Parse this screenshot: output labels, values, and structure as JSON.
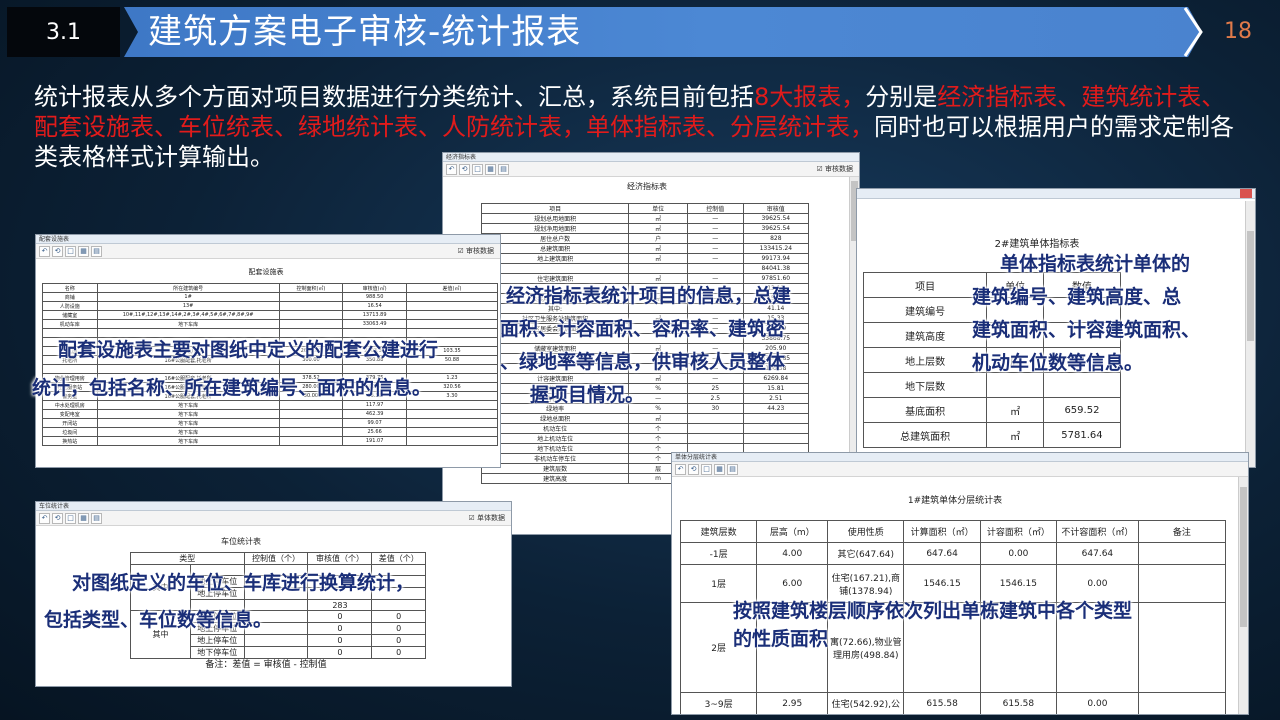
{
  "header": {
    "section": "3.1",
    "title": "建筑方案电子审核-统计报表",
    "page": "18"
  },
  "intro": {
    "p1": "统计报表从多个方面对项目数据进行分类统计、汇总，系统目前包括",
    "p2": "8大报表，",
    "p3": "分别是",
    "p4": "经济指标表、建筑统计表、配套设施表、车位统表、绿地统计表、人防统计表，单体指标表、分层统计表，",
    "p5": "同时也可以根据用户的需求定制各类表格样式计算输出。"
  },
  "toolbar_icons": [
    "back-icon",
    "refresh-icon",
    "page-icon",
    "export-icon",
    "print-icon"
  ],
  "econ": {
    "window_title": "经济指标表",
    "checkbox": "审核数据",
    "caption": "经济指标表",
    "headers": [
      "项目",
      "单位",
      "控制值",
      "审核值"
    ],
    "rows": [
      [
        "规划总用地面积",
        "㎡",
        "—",
        "39625.54"
      ],
      [
        "规划净用地面积",
        "㎡",
        "—",
        "39625.54"
      ],
      [
        "居住总户数",
        "户",
        "—",
        "828"
      ],
      [
        "总建筑面积",
        "㎡",
        "—",
        "133415.24"
      ],
      [
        "地上建筑面积",
        "㎡",
        "—",
        "99173.94"
      ],
      [
        "",
        "",
        "",
        "84041.38"
      ],
      [
        "住宅建筑面积",
        "㎡",
        "—",
        "97851.60"
      ],
      [
        "",
        "",
        "",
        "13.11"
      ],
      [
        "公共用房建筑面积",
        "㎡",
        "—",
        "15.14"
      ],
      [
        "其中:",
        "",
        "",
        "41.14"
      ],
      [
        "社区卫生服务站建筑面积",
        "㎡",
        "—",
        "15.33"
      ],
      [
        "社区居委会建筑面积",
        "㎡",
        "—",
        "701.89"
      ],
      [
        "",
        "",
        "",
        "33868.75"
      ],
      [
        "储藏室建筑面积",
        "㎡",
        "—",
        "205.90"
      ],
      [
        "",
        "㎡",
        "—",
        "33868.85"
      ],
      [
        "",
        "㎡",
        "—",
        "106.58"
      ],
      [
        "计容建筑面积",
        "㎡",
        "—",
        "6269.84"
      ],
      [
        "建筑密度",
        "%",
        "25",
        "15.81"
      ],
      [
        "容积率",
        "—",
        "2.5",
        "2.51"
      ],
      [
        "绿地率",
        "%",
        "30",
        "44.23"
      ],
      [
        "绿地总面积",
        "㎡",
        "",
        ""
      ],
      [
        "机动车位",
        "个",
        "",
        ""
      ],
      [
        "地上机动车位",
        "个",
        "",
        ""
      ],
      [
        "地下机动车位",
        "个",
        "",
        ""
      ],
      [
        "非机动车停车位",
        "个",
        "",
        ""
      ],
      [
        "建筑层数",
        "层",
        "",
        ""
      ],
      [
        "建筑高度",
        "m",
        "",
        ""
      ]
    ],
    "annotation": [
      "经济指标表统计项目的信息，总建",
      "面积、计容面积、容积率、建筑密",
      "、绿地率等信息，供审核人员整体",
      "握项目情况。"
    ]
  },
  "facility": {
    "window_title": "配套设施表",
    "checkbox": "审核数据",
    "caption": "配套设施表",
    "headers": [
      "名称",
      "所在建筑编号",
      "控制面积(㎡)",
      "审核值(㎡)",
      "差值(㎡)"
    ],
    "rows": [
      [
        "商铺",
        "1#",
        "",
        "988.50",
        ""
      ],
      [
        "人防设施",
        "13#",
        "",
        "16.54",
        ""
      ],
      [
        "储藏室",
        "10#,11#,12#,13#,14#,2#,3#,4#,5#,6#,7#,8#,9#",
        "",
        "13713.89",
        ""
      ],
      [
        "机动车库",
        "地下车库",
        "",
        "33063.49",
        ""
      ],
      [
        "",
        "",
        "",
        "",
        ""
      ],
      [
        "",
        "",
        "",
        "",
        ""
      ],
      [
        "幼儿园",
        "15#幼儿园",
        "2600.00",
        "2703.35",
        "103.35"
      ],
      [
        "托老所",
        "16#公服配套,托老所",
        "300.00",
        "350.88",
        "50.88"
      ],
      [
        "",
        "",
        "",
        "",
        ""
      ],
      [
        "物业管理用房",
        "16#公服配套,托老所",
        "378.52",
        "379.75",
        "1.23"
      ],
      [
        "社区服务站",
        "16#公服配套,托老所",
        "280.00",
        "600.56",
        "320.56"
      ],
      [
        "警务室",
        "16#公服配套,托老所",
        "30.00",
        "33.30",
        "3.30"
      ],
      [
        "中水处理机房",
        "地下车库",
        "",
        "117.97",
        ""
      ],
      [
        "变配电室",
        "地下车库",
        "",
        "462.39",
        ""
      ],
      [
        "开闭站",
        "地下车库",
        "",
        "99.07",
        ""
      ],
      [
        "垃圾间",
        "地下车库",
        "",
        "25.66",
        ""
      ],
      [
        "换热站",
        "地下车库",
        "",
        "191.07",
        ""
      ]
    ],
    "annotation": [
      "配套设施表主要对图纸中定义的配套公建进行",
      "统计，包括名称、所在建筑编号、面积的信息。"
    ]
  },
  "parking": {
    "window_title": "车位统计表",
    "checkbox": "单体数据",
    "caption": "车位统计表",
    "headers": [
      "类型",
      "控制值（个）",
      "审核值（个）",
      "差值（个）"
    ],
    "group1": "其中",
    "group2": "其中",
    "rows": [
      [
        "",
        "",
        "",
        ""
      ],
      [
        "地上停车位",
        "",
        "",
        ""
      ],
      [
        "地上停车位",
        "",
        "",
        ""
      ],
      [
        "",
        "",
        "283",
        ""
      ],
      [
        "地下停车位",
        "",
        "0",
        "0"
      ],
      [
        "地上停车位",
        "",
        "0",
        "0"
      ],
      [
        "地上停车位",
        "",
        "0",
        "0"
      ],
      [
        "地下停车位",
        "",
        "0",
        "0"
      ]
    ],
    "note": "备注：差值 = 审核值 - 控制值",
    "annotation": [
      "对图纸定义的车位、车库进行换算统计，",
      "包括类型、车位数等信息。"
    ]
  },
  "single": {
    "caption": "2#建筑单体指标表",
    "headers": [
      "项目",
      "单位",
      "数值"
    ],
    "rows": [
      [
        "建筑编号",
        "",
        ""
      ],
      [
        "建筑高度",
        "",
        ""
      ],
      [
        "地上层数",
        "层",
        "7"
      ],
      [
        "地下层数",
        "",
        ""
      ],
      [
        "基底面积",
        "㎡",
        "659.52"
      ],
      [
        "总建筑面积",
        "㎡",
        "5781.64"
      ]
    ],
    "annotation": [
      "单体指标表统计单体的",
      "建筑编号、建筑高度、总",
      "建筑面积、计容建筑面积、",
      "机动车位数等信息。"
    ]
  },
  "floor": {
    "window_title": "单体分层统计表",
    "caption": "1#建筑单体分层统计表",
    "headers": [
      "建筑层数",
      "层高（m）",
      "使用性质",
      "计算面积（㎡）",
      "计容面积（㎡）",
      "不计容面积（㎡）",
      "备注"
    ],
    "rows": [
      [
        "-1层",
        "4.00",
        "其它(647.64)",
        "647.64",
        "0.00",
        "647.64",
        ""
      ],
      [
        "1层",
        "6.00",
        "住宅(167.21),商铺(1378.94)",
        "1546.15",
        "1546.15",
        "0.00",
        ""
      ],
      [
        "2层",
        "",
        "寓(72.66),物业管理用房(498.84)",
        "",
        "",
        "",
        ""
      ],
      [
        "3~9层",
        "2.95",
        "住宅(542.92),公",
        "615.58",
        "615.58",
        "0.00",
        ""
      ]
    ],
    "annotation": [
      "按照建筑楼层顺序依次列出单栋建筑中各个类型",
      "的性质面积"
    ]
  }
}
